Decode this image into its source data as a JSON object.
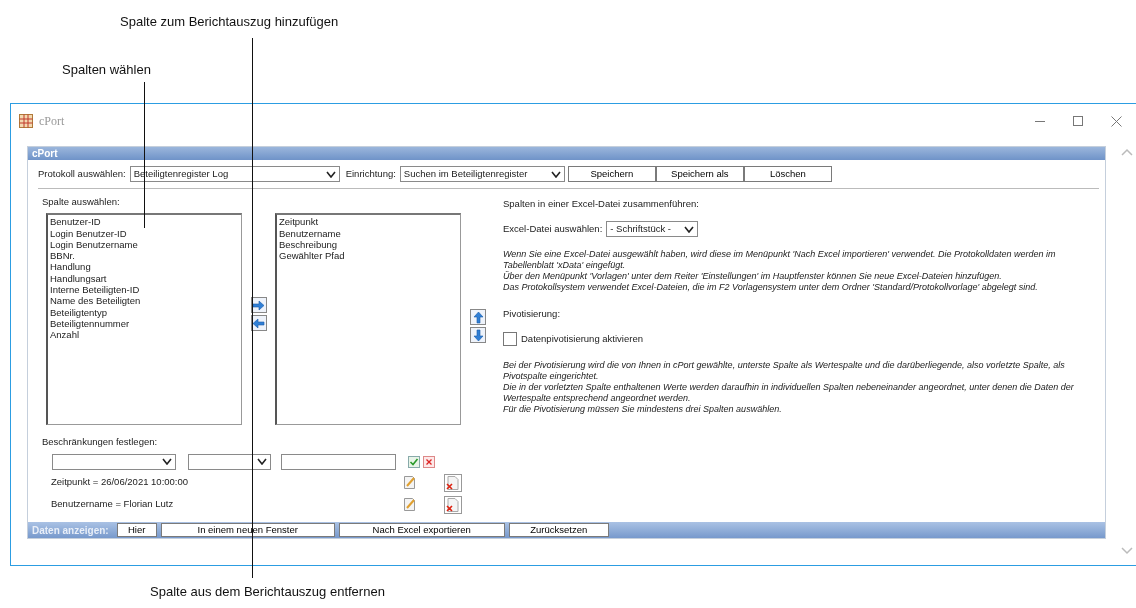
{
  "annotations": {
    "add_column": "Spalte zum Berichtauszug hinzufügen",
    "choose_columns": "Spalten wählen",
    "remove_column": "Spalte aus dem Berichtauszug entfernen"
  },
  "window": {
    "title": "cPort"
  },
  "panel": {
    "title": "cPort"
  },
  "protocol": {
    "label": "Protokoll auswählen:",
    "value": "Beteiligtenregister Log"
  },
  "setup": {
    "label": "Einrichtung:",
    "value": "Suchen im Beteiligtenregister"
  },
  "top_buttons": [
    "Speichern",
    "Speichern als",
    "Löschen"
  ],
  "columns_label": "Spalte auswählen:",
  "available_columns": [
    "Benutzer-ID",
    "Login Benutzer-ID",
    "Login Benutzername",
    "BBNr.",
    "Handlung",
    "Handlungsart",
    "Interne Beteiligten-ID",
    "Name des Beteiligten",
    "Beteiligtentyp",
    "Beteiligtennummer",
    "Anzahl"
  ],
  "selected_columns": [
    "Zeitpunkt",
    "Benutzername",
    "Beschreibung",
    "Gewählter Pfad"
  ],
  "constraints": {
    "label": "Beschränkungen festlegen:",
    "rows": [
      "Zeitpunkt = 26/06/2021 10:00:00",
      "Benutzername = Florian Lutz"
    ]
  },
  "excel": {
    "heading": "Spalten in einer Excel-Datei zusammenführen:",
    "label": "Excel-Datei auswählen:",
    "value": "- Schriftstück -",
    "info": [
      "Wenn Sie eine Excel-Datei ausgewählt haben, wird diese im Menüpunkt 'Nach Excel importieren' verwendet. Die Protokolldaten werden im Tabellenblatt 'xData' eingefügt.",
      "Über den Menüpunkt 'Vorlagen' unter dem Reiter 'Einstellungen' im Hauptfenster können Sie neue Excel-Dateien hinzufügen.",
      "Das Protokollsystem verwendet Excel-Dateien, die im F2 Vorlagensystem unter dem Ordner 'Standard/Protokollvorlage' abgelegt sind."
    ]
  },
  "pivot": {
    "heading": "Pivotisierung:",
    "checkbox": {
      "label": "Datenpivotisierung aktivieren",
      "checked": false
    },
    "info": [
      "Bei der Pivotisierung wird die von Ihnen in cPort gewählte, unterste Spalte als Wertespalte und die darüberliegende, also vorletzte Spalte, als Pivotspalte eingerichtet.",
      "Die in der vorletzten Spalte enthaltenen Werte werden daraufhin in individuellen Spalten nebeneinander angeordnet, unter denen die Daten der Wertespalte entsprechend angeordnet werden.",
      "Für die Pivotisierung müssen Sie mindestens drei Spalten auswählen."
    ]
  },
  "footer": {
    "label": "Daten anzeigen:",
    "buttons": [
      "Hier",
      "In einem neuen Fenster",
      "Nach Excel exportieren",
      "Zurücksetzen"
    ]
  }
}
